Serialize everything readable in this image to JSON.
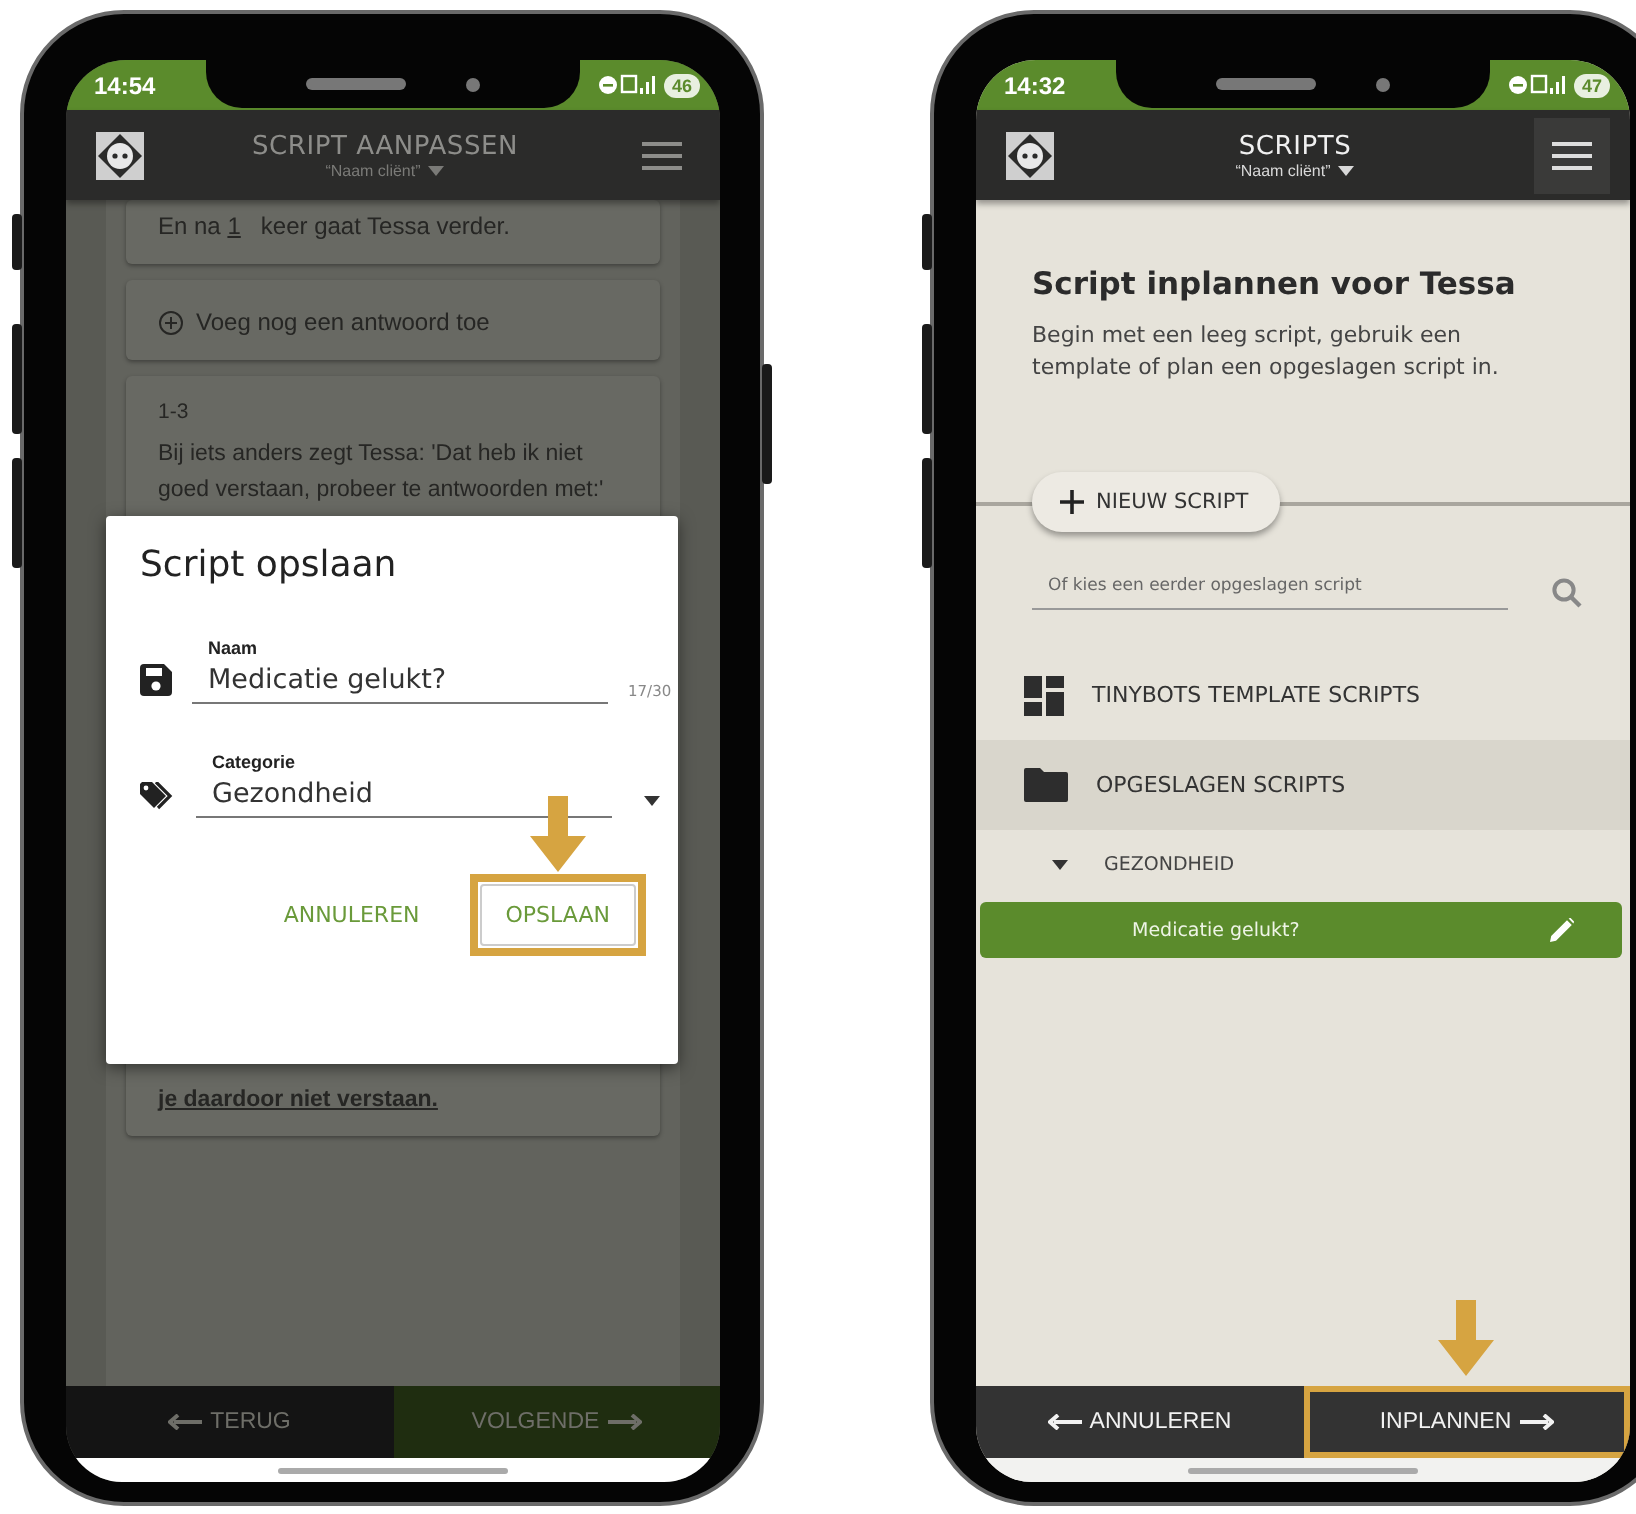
{
  "edit_screen": {
    "dimmed": true,
    "status": {
      "time": "14:54",
      "battery": "46"
    },
    "header": {
      "title": "SCRIPT AANPASSEN",
      "subtitle": "“Naam cliënt”"
    },
    "cards": [
      {
        "kind": "repeat",
        "prefix": "En na",
        "count": "1",
        "suffix": "keer gaat Tessa verder."
      },
      {
        "kind": "add",
        "label": "Voeg nog een antwoord toe"
      },
      {
        "kind": "text",
        "number": "1-3",
        "text": "Bij iets anders zegt Tessa: 'Dat heb ik niet goed verstaan, probeer te antwoorden met:'",
        "tail": "je daardoor niet verstaan."
      }
    ],
    "dialog": {
      "title": "Script opslaan",
      "fields": [
        {
          "kind": "text",
          "label": "Naam",
          "value": "Medicatie gelukt?",
          "counter": "17/30"
        },
        {
          "kind": "select",
          "label": "Categorie",
          "value": "Gezondheid"
        }
      ],
      "buttons": [
        {
          "label": "ANNULEREN",
          "highlighted": false
        },
        {
          "label": "OPSLAAN",
          "highlighted": true
        }
      ]
    },
    "nav": [
      {
        "label": "TERUG",
        "kind": "back",
        "primary": false,
        "highlighted": false
      },
      {
        "label": "VOLGENDE",
        "kind": "next",
        "primary": true,
        "highlighted": false
      }
    ]
  },
  "schedule_screen": {
    "dimmed": false,
    "status": {
      "time": "14:32",
      "battery": "47"
    },
    "header": {
      "title": "SCRIPTS",
      "subtitle": "“Naam cliënt”"
    },
    "heading": "Script inplannen voor Tessa",
    "description": "Begin met een leeg script, gebruik een template of plan een opgeslagen script in.",
    "new_button": "NIEUW SCRIPT",
    "search": {
      "placeholder": "Of kies een eerder opgeslagen script"
    },
    "sections": [
      {
        "kind": "templates",
        "label": "TINYBOTS TEMPLATE SCRIPTS",
        "selected": false
      },
      {
        "kind": "saved",
        "label": "OPGESLAGEN SCRIPTS",
        "selected": true,
        "children": [
          {
            "label": "GEZONDHEID",
            "expanded": true,
            "children": [
              {
                "label": "Medicatie gelukt?",
                "selected": true
              }
            ]
          }
        ]
      }
    ],
    "nav": [
      {
        "label": "ANNULEREN",
        "kind": "back",
        "primary": false,
        "highlighted": false
      },
      {
        "label": "INPLANNEN",
        "kind": "next",
        "primary": false,
        "highlighted": true
      }
    ]
  }
}
